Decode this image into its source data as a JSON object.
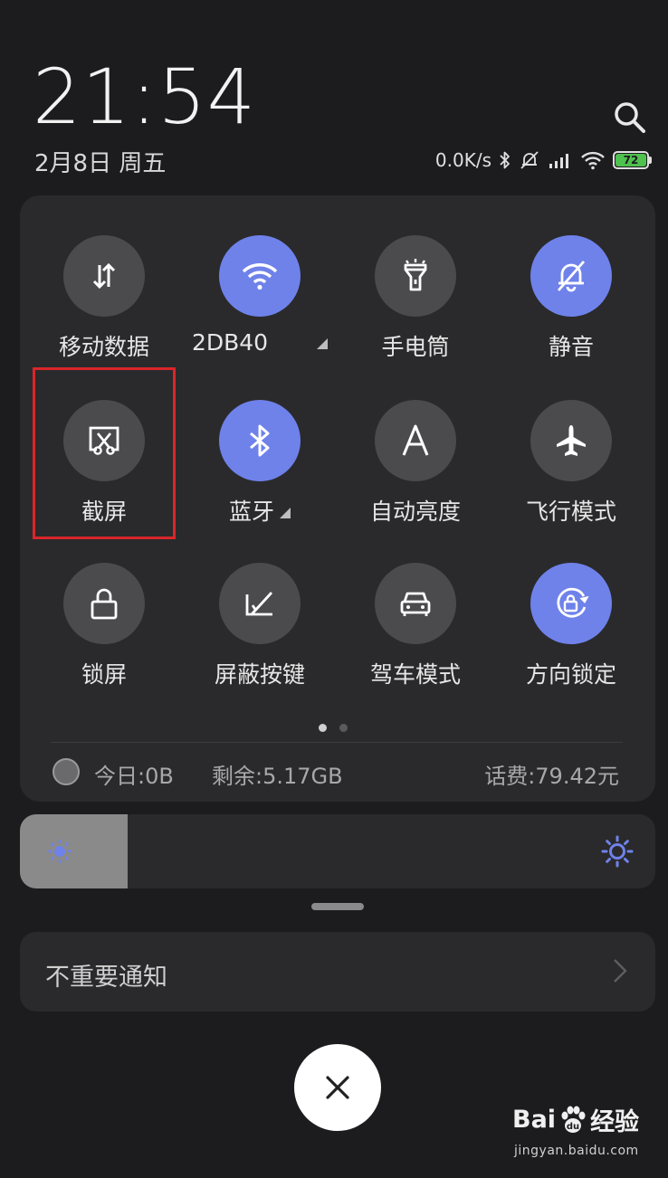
{
  "header": {
    "time": "21:54",
    "date": "2月8日 周五"
  },
  "status_bar": {
    "net_speed": "0.0K/s",
    "battery": "72",
    "icons": [
      "bluetooth-icon",
      "mute-icon",
      "signal-icon",
      "wifi-icon",
      "battery-icon"
    ]
  },
  "quick_settings": {
    "tiles": [
      {
        "label": "移动数据",
        "icon": "mobile-data-icon",
        "active": false
      },
      {
        "label": "2DB40",
        "icon": "wifi-icon",
        "active": true
      },
      {
        "label": "手电筒",
        "icon": "flashlight-icon",
        "active": false
      },
      {
        "label": "静音",
        "icon": "mute-bell-icon",
        "active": true
      },
      {
        "label": "截屏",
        "icon": "screenshot-icon",
        "active": false
      },
      {
        "label": "蓝牙",
        "icon": "bluetooth-icon",
        "active": true
      },
      {
        "label": "自动亮度",
        "icon": "auto-brightness-icon",
        "active": false
      },
      {
        "label": "飞行模式",
        "icon": "airplane-icon",
        "active": false
      },
      {
        "label": "锁屏",
        "icon": "lock-icon",
        "active": false
      },
      {
        "label": "屏蔽按键",
        "icon": "block-keys-icon",
        "active": false
      },
      {
        "label": "驾车模式",
        "icon": "car-icon",
        "active": false
      },
      {
        "label": "方向锁定",
        "icon": "rotation-lock-icon",
        "active": true
      }
    ],
    "page_count": 2,
    "current_page": 1
  },
  "data_usage": {
    "today": "今日:0B",
    "remaining": "剩余:5.17GB",
    "balance": "话费:79.42元"
  },
  "brightness": {
    "level_percent": 17
  },
  "notification_group": {
    "label": "不重要通知"
  },
  "close_button": {
    "glyph": "✕"
  },
  "watermark": {
    "brand_left": "Bai",
    "brand_right": "经验",
    "url": "jingyan.baidu.com"
  },
  "colors": {
    "active_tile": "#6f82ea",
    "inactive_tile": "#4b4b4d",
    "highlight_box": "#d9262b",
    "battery": "#4fc14f"
  }
}
